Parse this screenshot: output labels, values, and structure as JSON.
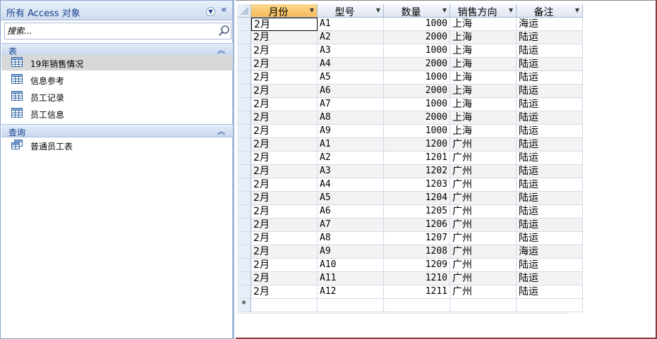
{
  "nav": {
    "title": "所有 Access 对象",
    "search_placeholder": "搜索...",
    "groups": [
      {
        "title": "表",
        "items": [
          {
            "label": "19年销售情况",
            "selected": true
          },
          {
            "label": "信息参考"
          },
          {
            "label": "员工记录"
          },
          {
            "label": "员工信息"
          }
        ]
      },
      {
        "title": "查询",
        "items": [
          {
            "label": "普通员工表"
          }
        ]
      }
    ]
  },
  "sheet": {
    "columns": [
      "月份",
      "型号",
      "数量",
      "销售方向",
      "备注"
    ],
    "active_column": "月份",
    "new_row_marker": "*",
    "rows": [
      [
        "2月",
        "A1",
        "1000",
        "上海",
        "海运"
      ],
      [
        "2月",
        "A2",
        "2000",
        "上海",
        "陆运"
      ],
      [
        "2月",
        "A3",
        "1000",
        "上海",
        "陆运"
      ],
      [
        "2月",
        "A4",
        "2000",
        "上海",
        "陆运"
      ],
      [
        "2月",
        "A5",
        "1000",
        "上海",
        "陆运"
      ],
      [
        "2月",
        "A6",
        "2000",
        "上海",
        "陆运"
      ],
      [
        "2月",
        "A7",
        "1000",
        "上海",
        "陆运"
      ],
      [
        "2月",
        "A8",
        "2000",
        "上海",
        "陆运"
      ],
      [
        "2月",
        "A9",
        "1000",
        "上海",
        "陆运"
      ],
      [
        "2月",
        "A1",
        "1200",
        "广州",
        "陆运"
      ],
      [
        "2月",
        "A2",
        "1201",
        "广州",
        "陆运"
      ],
      [
        "2月",
        "A3",
        "1202",
        "广州",
        "陆运"
      ],
      [
        "2月",
        "A4",
        "1203",
        "广州",
        "陆运"
      ],
      [
        "2月",
        "A5",
        "1204",
        "广州",
        "陆运"
      ],
      [
        "2月",
        "A6",
        "1205",
        "广州",
        "陆运"
      ],
      [
        "2月",
        "A7",
        "1206",
        "广州",
        "陆运"
      ],
      [
        "2月",
        "A8",
        "1207",
        "广州",
        "陆运"
      ],
      [
        "2月",
        "A9",
        "1208",
        "广州",
        "海运"
      ],
      [
        "2月",
        "A10",
        "1209",
        "广州",
        "陆运"
      ],
      [
        "2月",
        "A11",
        "1210",
        "广州",
        "陆运"
      ],
      [
        "2月",
        "A12",
        "1211",
        "广州",
        "陆运"
      ]
    ]
  },
  "colors": {
    "nav_text": "#15428b",
    "active_header": "#f6b95a",
    "window_border": "#8b3a3a"
  }
}
